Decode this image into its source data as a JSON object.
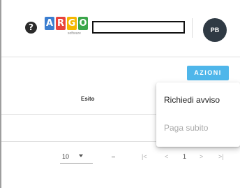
{
  "header": {
    "help_glyph": "?",
    "logo": {
      "letters": [
        "A",
        "R",
        "G",
        "O"
      ],
      "colors": [
        "#3b7ed0",
        "#e8433b",
        "#f5b700",
        "#3aa64b"
      ],
      "subtitle": "software"
    },
    "search_value": "",
    "user_initials": "PB"
  },
  "toolbar": {
    "azioni_label": "AZIONI"
  },
  "table": {
    "columns": [
      "Esito"
    ]
  },
  "pagination": {
    "page_size": "10",
    "range": "–",
    "current_page": "1",
    "first_glyph": "|<",
    "prev_glyph": "<",
    "next_glyph": ">",
    "last_glyph": ">|"
  },
  "actions_menu": {
    "items": [
      {
        "label": "Richiedi avviso",
        "enabled": true
      },
      {
        "label": "Paga subito",
        "enabled": false
      }
    ]
  }
}
